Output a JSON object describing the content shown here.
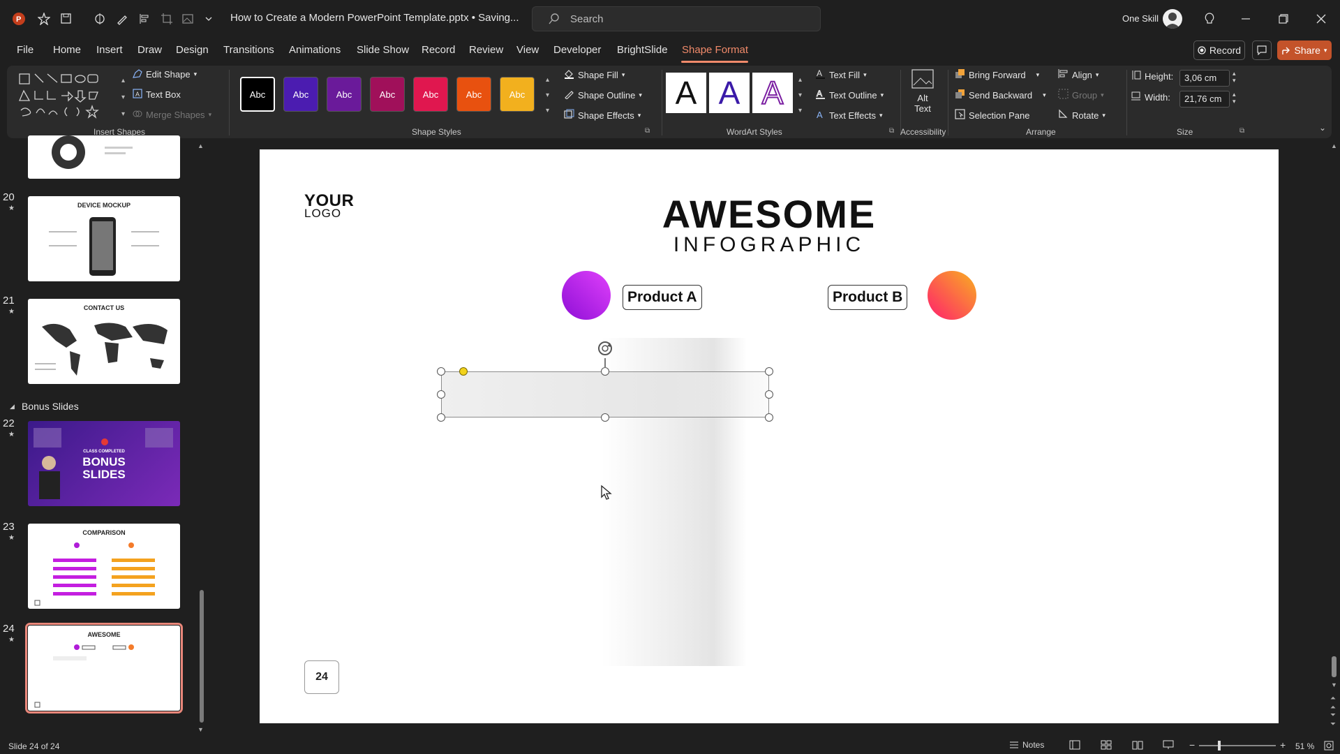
{
  "titlebar": {
    "doc_title": "How to Create a Modern PowerPoint Template.pptx • Saving...",
    "search_placeholder": "Search",
    "user_name": "One Skill"
  },
  "tabs": [
    "File",
    "Home",
    "Insert",
    "Draw",
    "Design",
    "Transitions",
    "Animations",
    "Slide Show",
    "Record",
    "Review",
    "View",
    "Developer",
    "BrightSlide",
    "Shape Format"
  ],
  "active_tab": "Shape Format",
  "actions": {
    "record": "Record",
    "share": "Share"
  },
  "ribbon": {
    "insert_shapes": {
      "label": "Insert Shapes",
      "edit_shape": "Edit Shape",
      "text_box": "Text Box",
      "merge_shapes": "Merge Shapes"
    },
    "shape_styles": {
      "label": "Shape Styles",
      "swatch_text": "Abc",
      "swatches": [
        "#000000",
        "#4b1cb0",
        "#6a1a9a",
        "#a0105a",
        "#e0174f",
        "#e8510f",
        "#f2b01e"
      ],
      "shape_fill": "Shape Fill",
      "shape_outline": "Shape Outline",
      "shape_effects": "Shape Effects"
    },
    "wordart_styles": {
      "label": "WordArt Styles",
      "letter": "A",
      "text_fill": "Text Fill",
      "text_outline": "Text Outline",
      "text_effects": "Text Effects"
    },
    "accessibility": {
      "label": "Accessibility",
      "alt_text_1": "Alt",
      "alt_text_2": "Text"
    },
    "arrange": {
      "label": "Arrange",
      "bring_forward": "Bring Forward",
      "send_backward": "Send Backward",
      "selection_pane": "Selection Pane",
      "align": "Align",
      "group": "Group",
      "rotate": "Rotate"
    },
    "size": {
      "label": "Size",
      "height_label": "Height:",
      "height_value": "3,06 cm",
      "width_label": "Width:",
      "width_value": "21,76 cm"
    }
  },
  "panel": {
    "section_label": "Bonus Slides",
    "slides": [
      {
        "num": "20",
        "title": "DEVICE MOCKUP"
      },
      {
        "num": "21",
        "title": "CONTACT US"
      },
      {
        "num": "22",
        "title": "BONUS SLIDES",
        "subtitle": "CLASS COMPLETED"
      },
      {
        "num": "23",
        "title": "COMPARISON"
      },
      {
        "num": "24",
        "title": "AWESOME"
      }
    ]
  },
  "slide": {
    "logo_line1": "YOUR",
    "logo_line2": "LOGO",
    "title": "AWESOME",
    "subtitle": "INFOGRAPHIC",
    "product_a": "Product A",
    "product_b": "Product B",
    "page_number": "24",
    "colors": {
      "product_a_gradient": [
        "#e040fb",
        "#8e0fd6"
      ],
      "product_b_gradient": [
        "#ff1f6d",
        "#f9b020"
      ]
    }
  },
  "status": {
    "slide_info": "Slide 24 of 24",
    "notes": "Notes",
    "zoom": "51 %"
  }
}
